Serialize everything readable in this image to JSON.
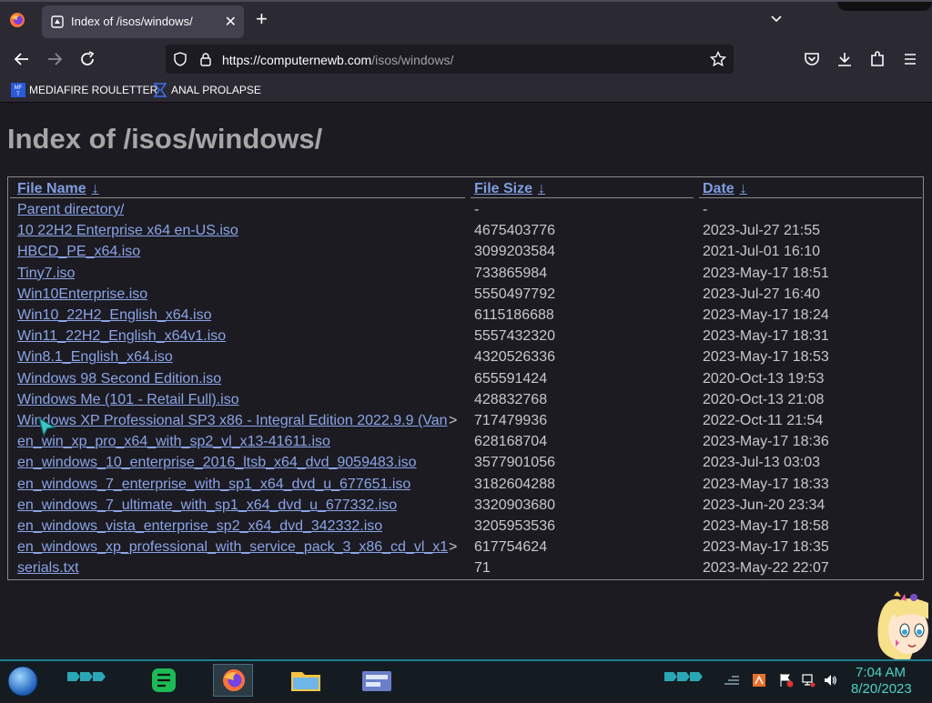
{
  "browser": {
    "tab_title": "Index of /isos/windows/",
    "url_host": "https://computernewb.com",
    "url_path": "/isos/windows/",
    "bookmarks": [
      "MEDIAFIRE ROULETTER",
      "ANAL PROLAPSE"
    ]
  },
  "page": {
    "title": "Index of /isos/windows/",
    "columns": [
      "File Name",
      "File Size",
      "Date"
    ],
    "sort_arrow": "↓",
    "files": [
      {
        "name": "Parent directory/",
        "size": "-",
        "date": "-",
        "truncated": false
      },
      {
        "name": "10 22H2 Enterprise x64 en-US.iso",
        "size": "4675403776",
        "date": "2023-Jul-27 21:55",
        "truncated": false
      },
      {
        "name": "HBCD_PE_x64.iso",
        "size": "3099203584",
        "date": "2021-Jul-01 16:10",
        "truncated": false
      },
      {
        "name": "Tiny7.iso",
        "size": "733865984",
        "date": "2023-May-17 18:51",
        "truncated": false
      },
      {
        "name": "Win10Enterprise.iso",
        "size": "5550497792",
        "date": "2023-Jul-27 16:40",
        "truncated": false
      },
      {
        "name": "Win10_22H2_English_x64.iso",
        "size": "6115186688",
        "date": "2023-May-17 18:24",
        "truncated": false
      },
      {
        "name": "Win11_22H2_English_x64v1.iso",
        "size": "5557432320",
        "date": "2023-May-17 18:31",
        "truncated": false
      },
      {
        "name": "Win8.1_English_x64.iso",
        "size": "4320526336",
        "date": "2023-May-17 18:53",
        "truncated": false
      },
      {
        "name": "Windows 98 Second Edition.iso",
        "size": "655591424",
        "date": "2020-Oct-13 19:53",
        "truncated": false
      },
      {
        "name": "Windows Me (101 - Retail Full).iso",
        "size": "428832768",
        "date": "2020-Oct-13 21:08",
        "truncated": false
      },
      {
        "name": "Windows XP Professional SP3 x86 - Integral Edition 2022.9.9 (Van",
        "size": "717479936",
        "date": "2022-Oct-11 21:54",
        "truncated": true
      },
      {
        "name": "en_win_xp_pro_x64_with_sp2_vl_x13-41611.iso",
        "size": "628168704",
        "date": "2023-May-17 18:36",
        "truncated": false
      },
      {
        "name": "en_windows_10_enterprise_2016_ltsb_x64_dvd_9059483.iso",
        "size": "3577901056",
        "date": "2023-Jul-13 03:03",
        "truncated": false
      },
      {
        "name": "en_windows_7_enterprise_with_sp1_x64_dvd_u_677651.iso",
        "size": "3182604288",
        "date": "2023-May-17 18:33",
        "truncated": false
      },
      {
        "name": "en_windows_7_ultimate_with_sp1_x64_dvd_u_677332.iso",
        "size": "3320903680",
        "date": "2023-Jun-20 23:34",
        "truncated": false
      },
      {
        "name": "en_windows_vista_enterprise_sp2_x64_dvd_342332.iso",
        "size": "3205953536",
        "date": "2023-May-17 18:58",
        "truncated": false
      },
      {
        "name": "en_windows_xp_professional_with_service_pack_3_x86_cd_vl_x1",
        "size": "617754624",
        "date": "2023-May-17 18:35",
        "truncated": true
      },
      {
        "name": "serials.txt",
        "size": "71",
        "date": "2023-May-22 22:07",
        "truncated": false
      }
    ],
    "truncation_marker": ">"
  },
  "taskbar": {
    "time": "7:04 AM",
    "date": "8/20/2023",
    "apps": [
      "notes-app",
      "firefox",
      "file-explorer",
      "control-panel"
    ]
  },
  "colors": {
    "link": "#8aa4e6",
    "header_link": "#7f9de0",
    "page_bg": "#1c1b22",
    "browser_chrome": "#2b2a33",
    "clock": "#4fd1c5"
  }
}
